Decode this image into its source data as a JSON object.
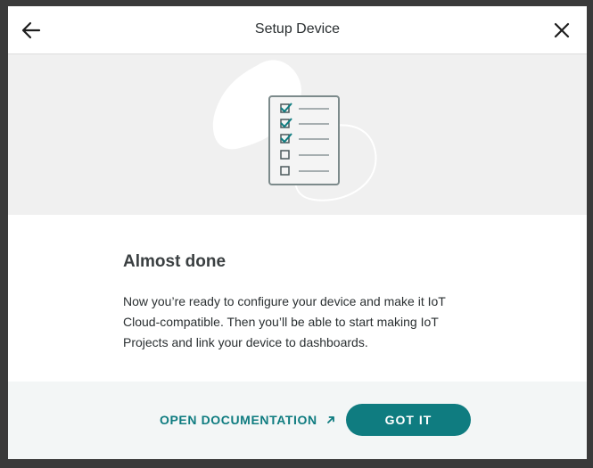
{
  "header": {
    "title": "Setup Device",
    "back_icon": "arrow-left-icon",
    "close_icon": "close-icon"
  },
  "illustration": {
    "icon": "checklist-icon",
    "checked_items": 3,
    "total_items": 5
  },
  "main": {
    "heading": "Almost done",
    "body": "Now you’re ready to configure your device and make it IoT Cloud-compatible. Then you’ll be able to start making IoT Projects and link your device to dashboards."
  },
  "footer": {
    "doc_link_label": "OPEN DOCUMENTATION",
    "doc_link_icon": "external-link-arrow-icon",
    "primary_button_label": "GOT IT"
  },
  "colors": {
    "accent": "#0f7c80",
    "text": "#2a2f31",
    "illustration_bg": "#f0f0f0",
    "footer_bg": "#f3f6f6"
  }
}
